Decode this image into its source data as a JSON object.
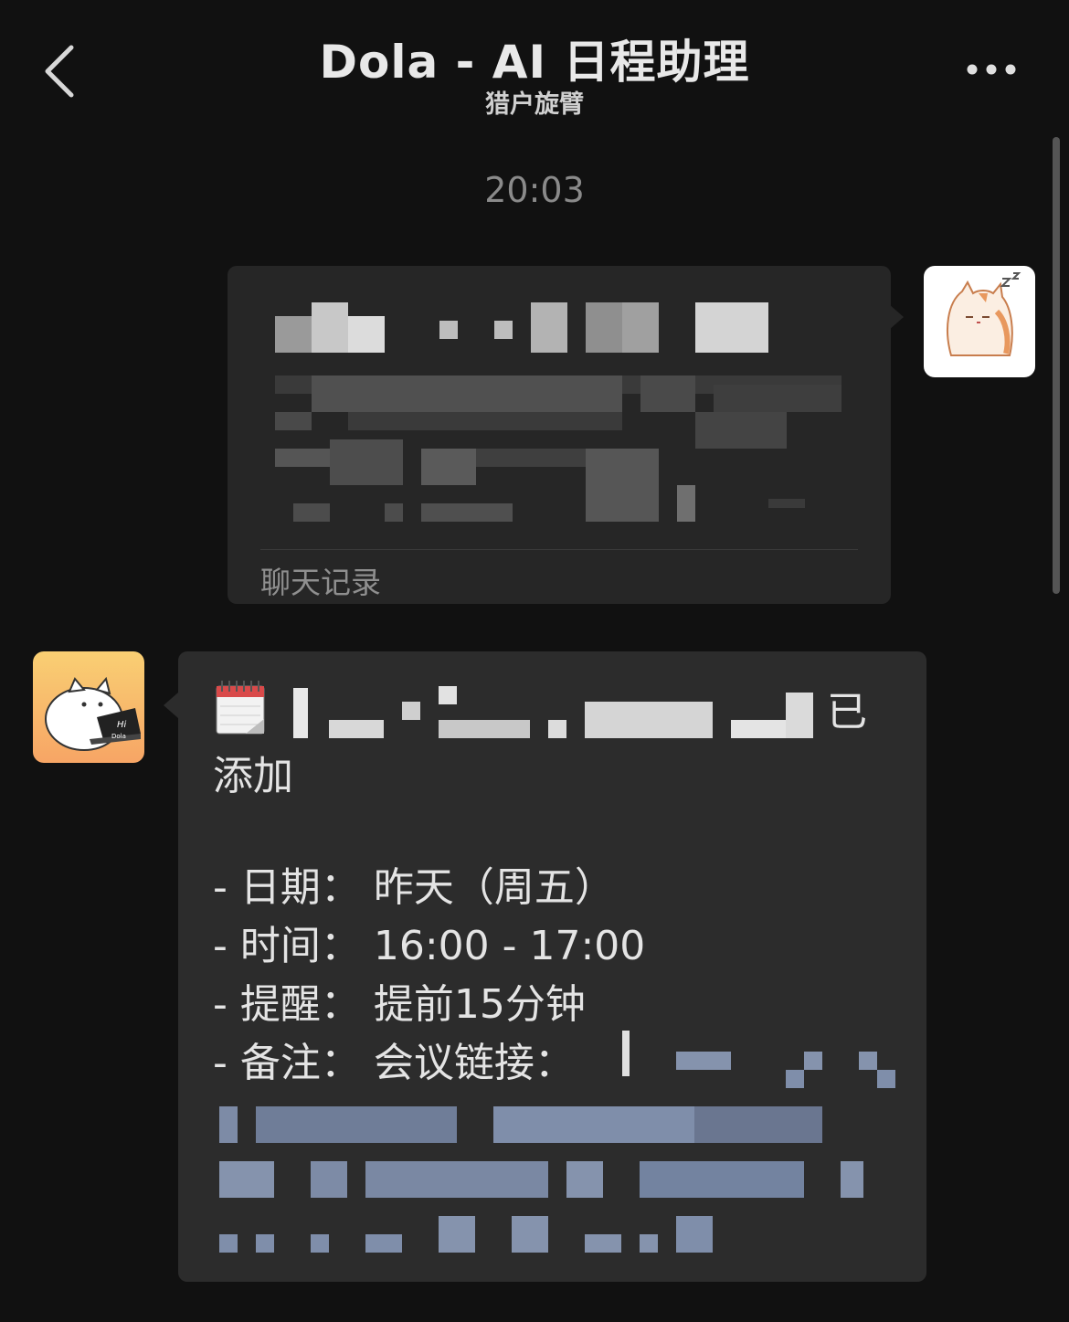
{
  "header": {
    "title": "Dola - AI 日程助理",
    "subtitle": "猎户旋臂"
  },
  "chat": {
    "timestamp": "20:03",
    "record_label": "聊天记录",
    "bot_message": {
      "added_suffix": "已",
      "added_line2": "添加",
      "date_line": "- 日期：  昨天（周五）",
      "time_line": "- 时间：  16:00 - 17:00",
      "reminder_line": "- 提醒：  提前15分钟",
      "note_line": "- 备注：  会议链接："
    }
  },
  "icons": [
    "back-arrow-icon",
    "more-icon",
    "calendar-icon",
    "cat-avatar",
    "dola-cat-avatar"
  ],
  "colors": {
    "background": "#111111",
    "bubble_record": "#262626",
    "bubble_bot": "#2c2c2c",
    "link_blur": "#7f8eaa"
  }
}
